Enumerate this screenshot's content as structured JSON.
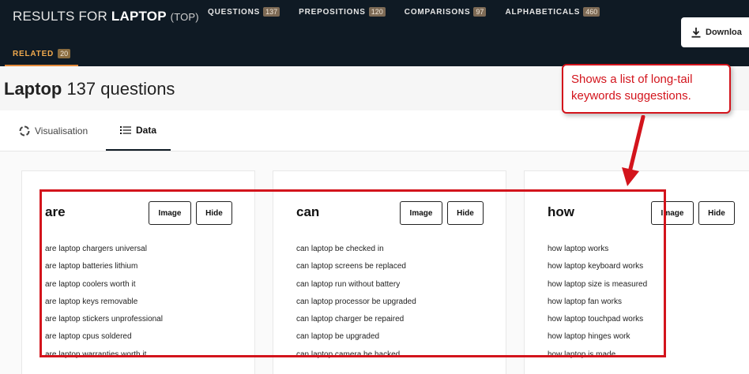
{
  "header": {
    "results_prefix": "RESULTS FOR ",
    "keyword": "LAPTOP",
    "mode": "(TOP)",
    "nav": [
      {
        "label": "QUESTIONS",
        "count": "137"
      },
      {
        "label": "PREPOSITIONS",
        "count": "120"
      },
      {
        "label": "COMPARISONS",
        "count": "97"
      },
      {
        "label": "ALPHABETICALS",
        "count": "460"
      }
    ],
    "related": {
      "label": "RELATED",
      "count": "20"
    },
    "download_label": "Downloa",
    "download_icon": "download-icon"
  },
  "page": {
    "title_keyword": "Laptop",
    "title_rest": " 137 questions"
  },
  "tabs": [
    {
      "label": "Visualisation",
      "icon": "spinner-icon",
      "active": false
    },
    {
      "label": "Data",
      "icon": "list-icon",
      "active": true
    }
  ],
  "cards": [
    {
      "title": "are",
      "image_label": "Image",
      "hide_label": "Hide",
      "questions": [
        "are laptop chargers universal",
        "are laptop batteries lithium",
        "are laptop coolers worth it",
        "are laptop keys removable",
        "are laptop stickers unprofessional",
        "are laptop cpus soldered",
        "are laptop warranties worth it"
      ]
    },
    {
      "title": "can",
      "image_label": "Image",
      "hide_label": "Hide",
      "questions": [
        "can laptop be checked in",
        "can laptop screens be replaced",
        "can laptop run without battery",
        "can laptop processor be upgraded",
        "can laptop charger be repaired",
        "can laptop be upgraded",
        "can laptop camera be hacked"
      ]
    },
    {
      "title": "how",
      "image_label": "Image",
      "hide_label": "Hide",
      "questions": [
        "how laptop works",
        "how laptop keyboard works",
        "how laptop size is measured",
        "how laptop fan works",
        "how laptop touchpad works",
        "how laptop hinges work",
        "how laptop is made"
      ]
    }
  ],
  "annotation": {
    "line1": "Shows a list of long-tail",
    "line2": "keywords suggestions.",
    "color": "#d3141c"
  }
}
